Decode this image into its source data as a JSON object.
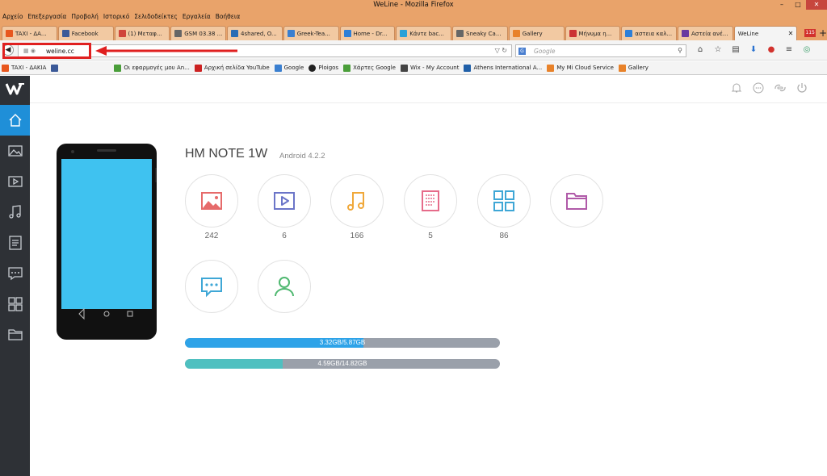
{
  "window": {
    "title": "WeLine - Mozilla Firefox",
    "minimize": "–",
    "maximize": "□",
    "close": "✕"
  },
  "menu": [
    "Αρχείο",
    "Επεξεργασία",
    "Προβολή",
    "Ιστορικό",
    "Σελιδοδείκτες",
    "Εργαλεία",
    "Βοήθεια"
  ],
  "tabs": [
    {
      "label": "TAXI - ΔΑ...",
      "color": "#e8571e"
    },
    {
      "label": "Facebook",
      "color": "#3b5998"
    },
    {
      "label": "(1) Μεταφ...",
      "color": "#d0443a"
    },
    {
      "label": "GSM 03.38 ...",
      "color": "#666666"
    },
    {
      "label": "4shared, O...",
      "color": "#2a6cb4"
    },
    {
      "label": "Greek-Tea...",
      "color": "#3a7fd0"
    },
    {
      "label": "Home - Dr...",
      "color": "#2d7fd8"
    },
    {
      "label": "Κάντε bac...",
      "color": "#2aa1d8"
    },
    {
      "label": "Sneaky Ca...",
      "color": "#666666"
    },
    {
      "label": "Gallery",
      "color": "#e8822a"
    },
    {
      "label": "Μήνυμα η...",
      "color": "#cc3333"
    },
    {
      "label": "αστεια καλ...",
      "color": "#2d7fd8"
    },
    {
      "label": "Αστεία ανέ...",
      "color": "#6a3aa0"
    },
    {
      "label": "WeLine",
      "close": "✕"
    }
  ],
  "tab_badge": "115",
  "new_tab": "+",
  "nav": {
    "url": "weline.cc",
    "search_placeholder": "Google",
    "search_engine": "G"
  },
  "bookmarks": [
    {
      "label": "TAXI - ΔΑΚΙΑ",
      "color": "#e8571e"
    },
    {
      "label": "",
      "color": "#3b5998"
    },
    {
      "label": "Οι εφαρμογές μου An...",
      "color": "#4a9e3a"
    },
    {
      "label": "Αρχική σελίδα YouTube",
      "color": "#cc2222"
    },
    {
      "label": "Google",
      "color": "#3a7fd0"
    },
    {
      "label": "Ploigos",
      "color": "#222222"
    },
    {
      "label": "Χάρτες Google",
      "color": "#4a9e3a"
    },
    {
      "label": "Wix - My Account",
      "color": "#444444"
    },
    {
      "label": "Athens International A...",
      "color": "#1f5fa8"
    },
    {
      "label": "My Mi Cloud Service",
      "color": "#e8822a"
    },
    {
      "label": "Gallery",
      "color": "#e8822a"
    }
  ],
  "app": {
    "device_name": "HM NOTE 1W",
    "android_version": "Android 4.2.2",
    "categories": [
      {
        "name": "photos",
        "count": "242",
        "color": "#e66b6b"
      },
      {
        "name": "videos",
        "count": "6",
        "color": "#6b75c8"
      },
      {
        "name": "music",
        "count": "166",
        "color": "#f0a83a"
      },
      {
        "name": "documents",
        "count": "5",
        "color": "#e66b8a"
      },
      {
        "name": "apps",
        "count": "86",
        "color": "#3fa7d6"
      },
      {
        "name": "files",
        "count": "",
        "color": "#b05aa8"
      },
      {
        "name": "messages",
        "count": "",
        "color": "#3fa7d6"
      },
      {
        "name": "contacts",
        "count": "",
        "color": "#4fb870"
      }
    ],
    "storage": [
      {
        "label": "3.32GB/5.87GB",
        "used_fraction": 0.566,
        "color": "#2ea3e8"
      },
      {
        "label": "4.59GB/14.82GB",
        "used_fraction": 0.31,
        "color": "#4fc0c0"
      }
    ],
    "accent": "#1f8fd8",
    "sidebar_bg": "#2e3136"
  }
}
